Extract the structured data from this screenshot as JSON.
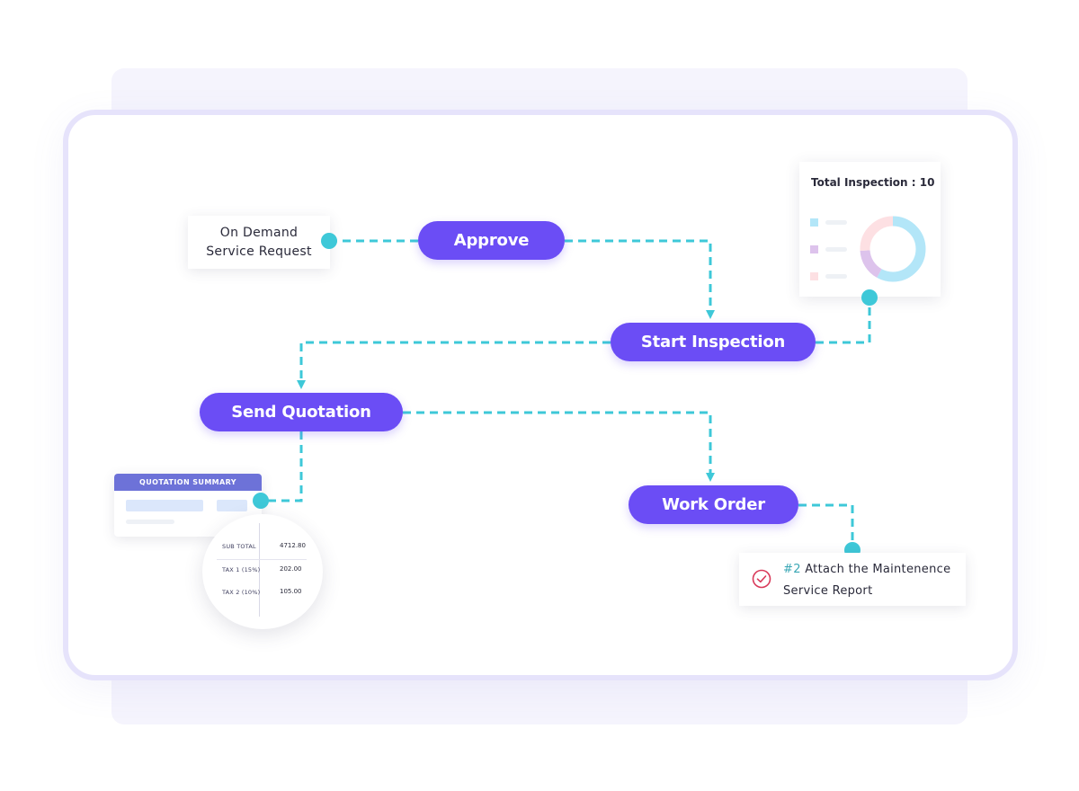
{
  "nodes": {
    "request": {
      "line1": "On Demand",
      "line2": "Service Request"
    },
    "approve": "Approve",
    "start_inspection": "Start Inspection",
    "send_quotation": "Send Quotation",
    "work_order": "Work Order"
  },
  "inspection_card": {
    "title": "Total Inspection : 10",
    "legend_colors": [
      "#b3e6f8",
      "#ddc3ec",
      "#fde0e3"
    ],
    "donut_segments": [
      {
        "color": "#b3e6f8",
        "fraction": 0.58
      },
      {
        "color": "#ddc3ec",
        "fraction": 0.16
      },
      {
        "color": "#fde0e3",
        "fraction": 0.26
      }
    ]
  },
  "quotation_card": {
    "header": "QUOTATION SUMMARY",
    "rows": [
      {
        "label": "SUB TOTAL",
        "value": "4712.80"
      },
      {
        "label": "TAX  1 (15%)",
        "value": "202.00"
      },
      {
        "label": "TAX 2 (10%)",
        "value": "105.00"
      }
    ]
  },
  "task_card": {
    "number": "#2",
    "line1": "Attach the Maintenence",
    "line2": "Service Report",
    "icon": "check-circle-icon"
  },
  "colors": {
    "primary": "#6b4df5",
    "connector": "#3ec8d8",
    "card_border": "#e6e3fb",
    "check": "#d93a5a"
  }
}
